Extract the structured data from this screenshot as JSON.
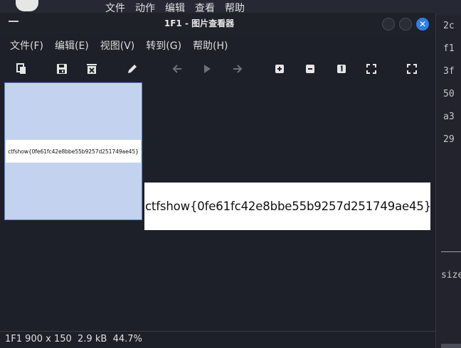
{
  "desktop": {
    "top_menu": [
      "文件",
      "动作",
      "编辑",
      "查看",
      "帮助"
    ],
    "editor_hex": [
      "2c",
      "f1",
      "3f",
      "50",
      "a3",
      "29"
    ],
    "editor_size_fragment": "size"
  },
  "window": {
    "title": "1F1 - 图片查看器",
    "close_glyph": "✕",
    "menu": [
      "文件(F)",
      "编辑(E)",
      "视图(V)",
      "转到(G)",
      "帮助(H)"
    ],
    "toolbar_icons": [
      "copy-icon",
      "save-icon",
      "delete-icon",
      "edit-icon",
      "back-arrow-icon",
      "play-icon",
      "forward-arrow-icon",
      "zoom-in-icon",
      "zoom-out-icon",
      "original-size-icon",
      "fit-icon",
      "fullscreen-icon"
    ],
    "thumbnail_text": "ctfshow{0fe61fc42e8bbe55b9257d251749ae45}",
    "image_text": "ctfshow{0fe61fc42e8bbe55b9257d251749ae45}",
    "status": {
      "filename": "1F1",
      "dimensions": "900 x 150",
      "filesize": "2.9 kB",
      "zoom": "44.7%"
    }
  },
  "colors": {
    "background": "#1e2029",
    "thumbnail_selected": "#c3d3ef",
    "close_button": "#2f7fe6"
  }
}
